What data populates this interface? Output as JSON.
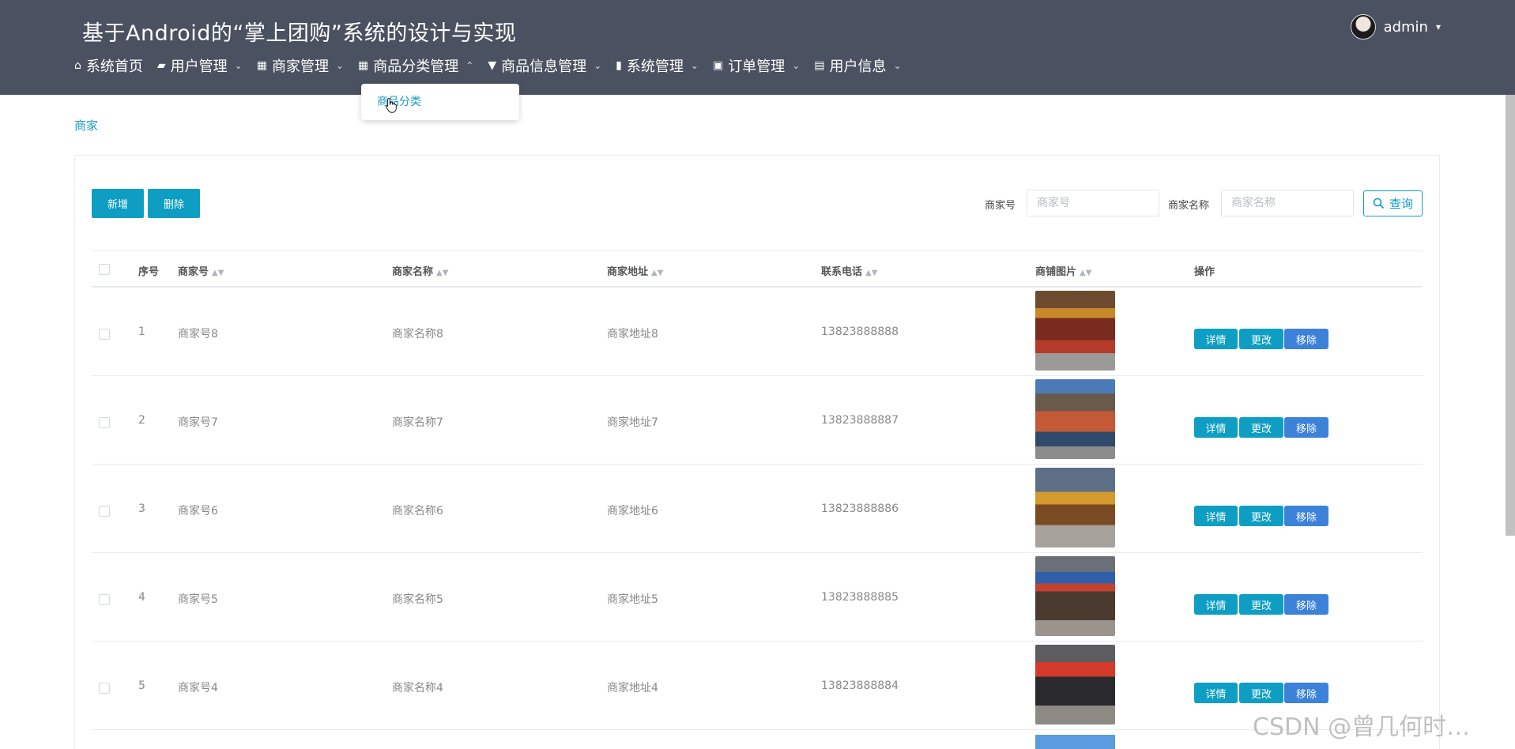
{
  "header": {
    "title": "基于Android的“掌上团购”系统的设计与实现",
    "user": {
      "name": "admin"
    }
  },
  "nav": [
    {
      "label": "系统首页",
      "icon": "home-icon"
    },
    {
      "label": "用户管理",
      "icon": "user-icon"
    },
    {
      "label": "商家管理",
      "icon": "grid-icon"
    },
    {
      "label": "商品分类管理",
      "icon": "grid-icon"
    },
    {
      "label": "商品信息管理",
      "icon": "goods-icon"
    },
    {
      "label": "系统管理",
      "icon": "chart-icon"
    },
    {
      "label": "订单管理",
      "icon": "bag-icon"
    },
    {
      "label": "用户信息",
      "icon": "card-icon"
    }
  ],
  "dropdown": {
    "items": [
      "商品分类"
    ]
  },
  "breadcrumb": "商家",
  "toolbar": {
    "add": "新增",
    "delete": "删除"
  },
  "search": {
    "merchant_no_label": "商家号",
    "merchant_no_placeholder": "商家号",
    "merchant_name_label": "商家名称",
    "merchant_name_placeholder": "商家名称",
    "query": "查询"
  },
  "table": {
    "headers": [
      "序号",
      "商家号",
      "商家名称",
      "商家地址",
      "联系电话",
      "商铺图片",
      "操作"
    ],
    "actions": {
      "detail": "详情",
      "edit": "更改",
      "remove": "移除"
    },
    "rows": [
      {
        "no": "1",
        "merchant_no": "商家号8",
        "name": "商家名称8",
        "address": "商家地址8",
        "phone": "13823888888"
      },
      {
        "no": "2",
        "merchant_no": "商家号7",
        "name": "商家名称7",
        "address": "商家地址7",
        "phone": "13823888887"
      },
      {
        "no": "3",
        "merchant_no": "商家号6",
        "name": "商家名称6",
        "address": "商家地址6",
        "phone": "13823888886"
      },
      {
        "no": "4",
        "merchant_no": "商家号5",
        "name": "商家名称5",
        "address": "商家地址5",
        "phone": "13823888885"
      },
      {
        "no": "5",
        "merchant_no": "商家号4",
        "name": "商家名称4",
        "address": "商家地址4",
        "phone": "13823888884"
      }
    ]
  },
  "colors": {
    "header_bg": "#4a5261",
    "primary": "#0e9ec4",
    "remove": "#3c82d8"
  },
  "watermark": "CSDN @曾几何时…"
}
